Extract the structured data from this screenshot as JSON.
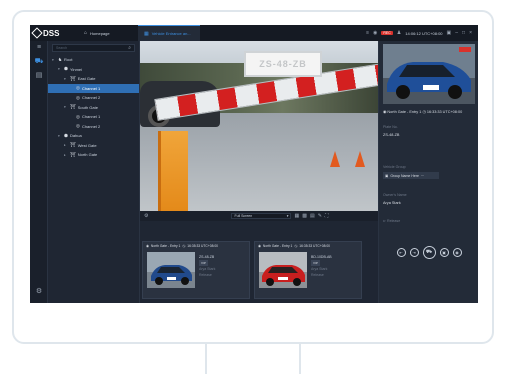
{
  "app": {
    "logo": "DSS",
    "tabs": [
      {
        "label": "Homepage",
        "icon": "home-icon"
      },
      {
        "label": "Vehicle Entrance an...",
        "icon": "grid-icon"
      }
    ],
    "status": {
      "rec_label": "REC",
      "time": "14:06:12 UTC+08:00"
    },
    "accent": "#3d8fe0"
  },
  "tree": {
    "search_placeholder": "Search",
    "items": [
      {
        "label": "Root",
        "icon": "organization-icon",
        "indent": 0,
        "expanded": true
      },
      {
        "label": "Yinmei",
        "icon": "location-icon",
        "indent": 1,
        "expanded": true
      },
      {
        "label": "East Gate",
        "icon": "gate-icon",
        "indent": 2,
        "expanded": true
      },
      {
        "label": "Channel 1",
        "icon": "camera-icon",
        "indent": 3,
        "selected": true
      },
      {
        "label": "Channel 2",
        "icon": "camera-icon",
        "indent": 3
      },
      {
        "label": "South Gate",
        "icon": "gate-icon",
        "indent": 2,
        "expanded": true
      },
      {
        "label": "Channel 1",
        "icon": "camera-icon",
        "indent": 3
      },
      {
        "label": "Channel 2",
        "icon": "camera-icon",
        "indent": 3
      },
      {
        "label": "Dahua",
        "icon": "location-icon",
        "indent": 1,
        "expanded": true
      },
      {
        "label": "West Gate",
        "icon": "gate-icon",
        "indent": 2
      },
      {
        "label": "North Gate",
        "icon": "gate-icon",
        "indent": 2
      }
    ]
  },
  "video": {
    "plate_text": "ZS-48-ZB",
    "layout_select": "Full Screen"
  },
  "records": [
    {
      "channel": "North Gate - Entry 1",
      "time": "16:35:33 UTC+08:00",
      "plate": "ZS-48-ZB",
      "vip": "VIP",
      "line1": "Arya Stark",
      "line2": "Release"
    },
    {
      "channel": "North Gate - Entry 1",
      "time": "16:35:33 UTC+08:00",
      "plate": "BD-10DB-AB",
      "vip": "VIP",
      "line1": "Arya Stark",
      "line2": "Release"
    }
  ],
  "detail": {
    "channel": "North Gate - Entry 1",
    "time": "16:33:33 UTC+08:00",
    "plate_label": "Plate No.",
    "plate_value": "ZS-48-ZB",
    "group_label": "Vehicle Group",
    "group_value": "Group Name Here",
    "owner_label": "Owner's Name",
    "owner_value": "Arya Stark",
    "release_label": "Release"
  }
}
